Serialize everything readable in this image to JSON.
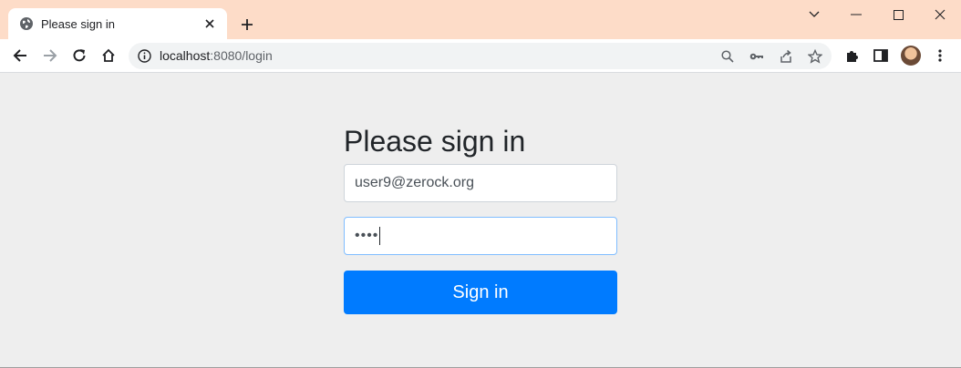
{
  "browser": {
    "tab": {
      "title": "Please sign in"
    },
    "address_bar": {
      "host": "localhost",
      "path": ":8080/login"
    },
    "icons": {
      "favicon": "globe-icon",
      "tab_close": "close-icon",
      "new_tab": "plus-icon",
      "tab_search": "chevron-down-icon",
      "minimize": "minimize-icon",
      "maximize": "maximize-icon",
      "window_close": "close-icon",
      "back": "arrow-left-icon",
      "forward": "arrow-right-icon",
      "reload": "reload-icon",
      "home": "home-icon",
      "site_info": "info-icon",
      "zoom": "search-icon",
      "passwords": "key-icon",
      "share": "share-icon",
      "bookmark": "star-icon",
      "extensions": "puzzle-icon",
      "side_panel": "side-panel-icon",
      "profile": "avatar",
      "menu": "more-vert-icon"
    }
  },
  "login": {
    "heading": "Please sign in",
    "username_value": "user9@zerock.org",
    "password_value": "••••",
    "submit_label": "Sign in"
  },
  "colors": {
    "titlebar": "#fddcc8",
    "page_background": "#eeeeee",
    "primary_button": "#007bff",
    "focus_border": "#80bdff"
  }
}
